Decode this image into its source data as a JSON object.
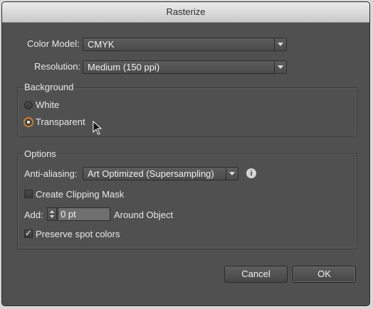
{
  "window": {
    "title": "Rasterize"
  },
  "color_model": {
    "label": "Color Model:",
    "value": "CMYK"
  },
  "resolution": {
    "label": "Resolution:",
    "value": "Medium (150 ppi)"
  },
  "background": {
    "title": "Background",
    "white_label": "White",
    "transparent_label": "Transparent",
    "selected": "Transparent"
  },
  "options": {
    "title": "Options",
    "anti_aliasing": {
      "label": "Anti-aliasing:",
      "value": "Art Optimized (Supersampling)"
    },
    "clipping_mask": {
      "label": "Create Clipping Mask",
      "checked": false
    },
    "add": {
      "label": "Add:",
      "value": "0 pt",
      "suffix": "Around Object"
    },
    "preserve_spot": {
      "label": "Preserve spot colors",
      "checked": true
    },
    "info_icon": "info-icon"
  },
  "buttons": {
    "cancel": "Cancel",
    "ok": "OK"
  },
  "colors": {
    "panel": "#505050",
    "radio_accent": "#d08a3a",
    "titlebar": "#dcdcdc"
  }
}
